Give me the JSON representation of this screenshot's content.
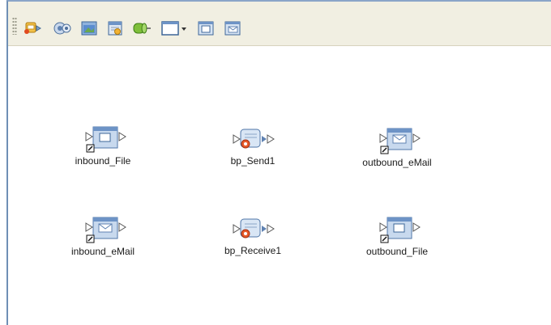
{
  "toolbar": {
    "buttons": [
      {
        "icon": "map-flow-icon"
      },
      {
        "icon": "service-icon"
      },
      {
        "icon": "external-application-icon"
      },
      {
        "icon": "schedule-icon"
      },
      {
        "icon": "connector-icon"
      },
      {
        "icon": "window-dropdown-icon"
      },
      {
        "icon": "file-external-icon"
      },
      {
        "icon": "email-external-icon"
      }
    ]
  },
  "nodes": [
    {
      "label": "inbound_File",
      "type": "file-external"
    },
    {
      "label": "bp_Send1",
      "type": "business-process"
    },
    {
      "label": "outbound_eMail",
      "type": "email-external"
    },
    {
      "label": "inbound_eMail",
      "type": "email-external"
    },
    {
      "label": "bp_Receive1",
      "type": "business-process"
    },
    {
      "label": "outbound_File",
      "type": "file-external"
    }
  ]
}
